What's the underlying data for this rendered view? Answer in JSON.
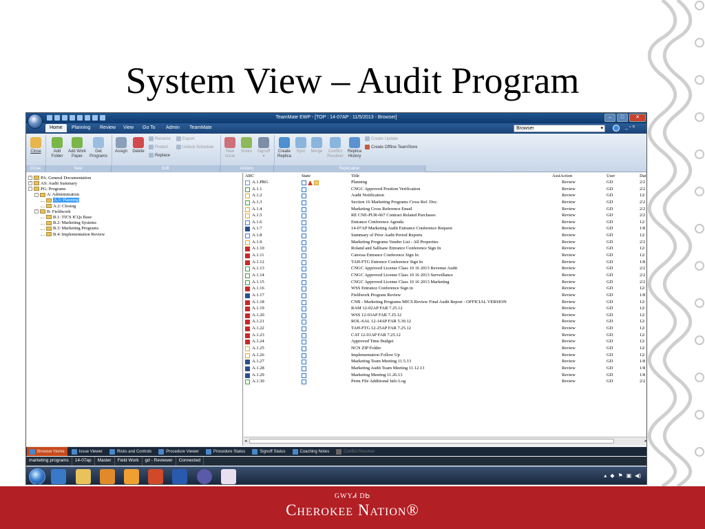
{
  "slide": {
    "title": "System View – Audit Program",
    "footer_syllabary": "GWYᏗ DᏏ",
    "footer_name": "Cherokee Nation®"
  },
  "window": {
    "title": "TeamMate EWP - [TOP : 14-07AP : 11/5/2013 - Browser]",
    "browse_dropdown": "Browser"
  },
  "menu": {
    "tabs": [
      "Home",
      "Planning",
      "Review",
      "View",
      "Go To",
      "Admin",
      "TeamMate"
    ]
  },
  "ribbon": {
    "close": "Close",
    "add_folder": "Add Folder",
    "add_work_paper": "Add Work Paper",
    "get_programs": "Get Programs",
    "assign": "Assign",
    "delete": "Delete",
    "rename": "Rename",
    "protect": "Protect",
    "replace": "Replace",
    "export": "Export",
    "unlock_schedule": "Unlock Schedule",
    "new_issue": "New Issue",
    "notes": "Notes",
    "signoff": "Signoff",
    "create_replica": "Create Replica",
    "sync": "Sync",
    "merge": "Merge",
    "conflict_resolver": "Conflict Resolver",
    "replica_history": "Replica History",
    "create_update": "Create Update",
    "create_offline_teamstore": "Create Offline TeamStore",
    "groups": {
      "close": "Close",
      "new": "New",
      "edit": "Edit",
      "actions": "Actions",
      "replication": "Replication"
    }
  },
  "tree": [
    {
      "label": "PA: General Documentation",
      "level": 0,
      "expander": "+"
    },
    {
      "label": "AS: Audit Summary",
      "level": 0,
      "expander": "+"
    },
    {
      "label": "PG: Programs",
      "level": 0,
      "expander": "-"
    },
    {
      "label": "A: Administration",
      "level": 1,
      "expander": "-"
    },
    {
      "label": "A.1: Planning",
      "level": 2,
      "expander": "",
      "selected": true
    },
    {
      "label": "A.2: Closing",
      "level": 2,
      "expander": ""
    },
    {
      "label": "B: Fieldwork",
      "level": 1,
      "expander": "-"
    },
    {
      "label": "B.1: TICS ICQs Base",
      "level": 2,
      "expander": ""
    },
    {
      "label": "B.2: Marketing Systems",
      "level": 2,
      "expander": ""
    },
    {
      "label": "B.3: Marketing Programs",
      "level": 2,
      "expander": ""
    },
    {
      "label": "B.4: Implementation Review",
      "level": 2,
      "expander": ""
    }
  ],
  "grid": {
    "headers": {
      "arc": "ARC",
      "state": "State",
      "title": "Title",
      "action": "AssiAction",
      "user": "User",
      "date": "Dat"
    },
    "rows": [
      {
        "icon": "prg",
        "arc": "A.1.PRG",
        "title": "Planning",
        "action": "Review",
        "user": "GD",
        "date": "2/2"
      },
      {
        "icon": "green",
        "arc": "A.1.1",
        "title": "CNGC Approved Position Verification",
        "action": "Review",
        "user": "GD",
        "date": "2/2"
      },
      {
        "icon": "yellow",
        "arc": "A.1.2",
        "title": "Audit Notification",
        "action": "Review",
        "user": "GD",
        "date": "12/"
      },
      {
        "icon": "green",
        "arc": "A.1.3",
        "title": "Section 16 Marketing Programs Cross Ref. Doc.",
        "action": "Review",
        "user": "GD",
        "date": "2/2"
      },
      {
        "icon": "yellow",
        "arc": "A.1.4",
        "title": "Marketing Cross Reference Email",
        "action": "Review",
        "user": "GD",
        "date": "2/2"
      },
      {
        "icon": "yellow",
        "arc": "A.1.5",
        "title": "RE CNE-PUR-667 Contract Related Purchases",
        "action": "Review",
        "user": "GD",
        "date": "2/2"
      },
      {
        "icon": "blue",
        "arc": "A.1.6",
        "title": "Entrance Conference Agenda",
        "action": "Review",
        "user": "GD",
        "date": "12/"
      },
      {
        "icon": "doc",
        "arc": "A.1.7",
        "title": "14-07AP Marketing Audit Entrance Conference Request",
        "action": "Review",
        "user": "GD",
        "date": "1/8"
      },
      {
        "icon": "blue",
        "arc": "A.1.8",
        "title": "Summary of Prior Audit Period Reports",
        "action": "Review",
        "user": "GD",
        "date": "12/"
      },
      {
        "icon": "yellow",
        "arc": "A.1.9",
        "title": "Marketing Programs Vender List - All Properties",
        "action": "Review",
        "user": "GD",
        "date": "2/2"
      },
      {
        "icon": "pdf",
        "arc": "A.1.10",
        "title": "Roland and Sallisaw Entrance Conference Sign In",
        "action": "Review",
        "user": "GD",
        "date": "12/"
      },
      {
        "icon": "pdf",
        "arc": "A.1.11",
        "title": "Catoosa Entrance Conference Sign In",
        "action": "Review",
        "user": "GD",
        "date": "12/"
      },
      {
        "icon": "pdf",
        "arc": "A.1.12",
        "title": "TAH-FTG Entrence Conference Sign In",
        "action": "Review",
        "user": "GD",
        "date": "1/8"
      },
      {
        "icon": "green",
        "arc": "A.1.13",
        "title": "CNGC Approved License Class 10 16 2013 Revenue Audit",
        "action": "Review",
        "user": "GD",
        "date": "2/2"
      },
      {
        "icon": "green",
        "arc": "A.1.14",
        "title": "CNGC Approved License Class 10 16 2013 Surveillance",
        "action": "Review",
        "user": "GD",
        "date": "2/2"
      },
      {
        "icon": "green",
        "arc": "A.1.15",
        "title": "CNGC Approved License Class 10 16 2013 Marketing",
        "action": "Review",
        "user": "GD",
        "date": "2/2"
      },
      {
        "icon": "pdf",
        "arc": "A.1.16",
        "title": "WSS Entrance Conference Sign in",
        "action": "Review",
        "user": "GD",
        "date": "12/"
      },
      {
        "icon": "doc",
        "arc": "A.1.17",
        "title": "Fieldwork Program Review",
        "action": "Review",
        "user": "GD",
        "date": "1/8"
      },
      {
        "icon": "pdf",
        "arc": "A.1.18",
        "title": "CNB - Marketing Programs MICS Review Final Audit Report - OFFICIAL VERSION",
        "action": "Review",
        "user": "GD",
        "date": "12/"
      },
      {
        "icon": "pdf",
        "arc": "A.1.19",
        "title": "RAM 12-02AP FAR 7.25.12",
        "action": "Review",
        "user": "GD",
        "date": "12/"
      },
      {
        "icon": "pdf",
        "arc": "A.1.20",
        "title": "WSS 12-03AP FAR 7.25.12",
        "action": "Review",
        "user": "GD",
        "date": "12/"
      },
      {
        "icon": "pdf",
        "arc": "A.1.21",
        "title": "ROL-SAL 12-14AP FAR 5.30.12",
        "action": "Review",
        "user": "GD",
        "date": "12/"
      },
      {
        "icon": "pdf",
        "arc": "A.1.22",
        "title": "TAH-FTG 12-25AP FAR 7.25.12",
        "action": "Review",
        "user": "GD",
        "date": "12/"
      },
      {
        "icon": "pdf",
        "arc": "A.1.23",
        "title": "CAT 12-01AP FAR 7.25.12",
        "action": "Review",
        "user": "GD",
        "date": "12/"
      },
      {
        "icon": "pdf",
        "arc": "A.1.24",
        "title": "Approved Time Budget",
        "action": "Review",
        "user": "GD",
        "date": "12/"
      },
      {
        "icon": "zip",
        "arc": "A.1.25",
        "title": "NCN ZIP Folder",
        "action": "Review",
        "user": "GD",
        "date": "12/"
      },
      {
        "icon": "yellow",
        "arc": "A.1.26",
        "title": "Implementation Follow Up",
        "action": "Review",
        "user": "GD",
        "date": "12/"
      },
      {
        "icon": "doc",
        "arc": "A.1.27",
        "title": "Marketing Team Meeting 11.5.13",
        "action": "Review",
        "user": "GD",
        "date": "1/8"
      },
      {
        "icon": "doc",
        "arc": "A.1.28",
        "title": "Marketing Audit Team Meeting 11.12.13",
        "action": "Review",
        "user": "GD",
        "date": "1/8"
      },
      {
        "icon": "doc",
        "arc": "A.1.29",
        "title": "Marketing Meeting 11.26.13",
        "action": "Review",
        "user": "GD",
        "date": "1/8"
      },
      {
        "icon": "green",
        "arc": "A.1.30",
        "title": "Perm File Additional Info Log",
        "action": "Review",
        "user": "GD",
        "date": "2/2"
      }
    ]
  },
  "view_tabs": [
    "Browser Home",
    "Issue Viewer",
    "Risks and Controls",
    "Procedure Viewer",
    "Procedure Status",
    "Signoff Status",
    "Coaching Notes",
    "Conflict Resolver"
  ],
  "status_bar": [
    "marketing programs",
    "14-07ap",
    "Master",
    "Field Work",
    "gd - Reviewer",
    "Connected"
  ],
  "icon_colors": {
    "green": "#3a9a3a",
    "yellow": "#e8a21a",
    "blue": "#3d7bd0",
    "pdf": "#c8282a",
    "doc": "#2a4f8f",
    "zip": "#c9b04a",
    "prg": "#5a8fd0"
  },
  "taskbar_icons": [
    "start-orb-icon",
    "internet-explorer-icon",
    "explorer-folder-icon",
    "media-player-icon",
    "outlook-icon",
    "powerpoint-icon",
    "word-icon",
    "app-icon",
    "teammate-icon"
  ]
}
